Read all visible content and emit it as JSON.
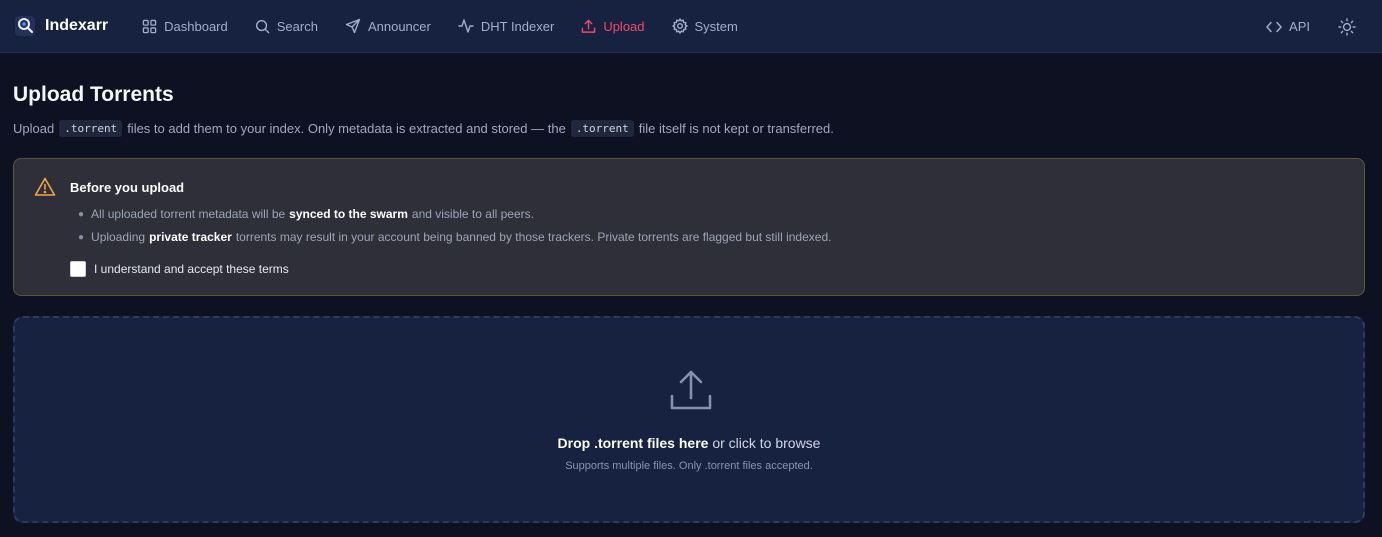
{
  "app": {
    "name": "Indexarr"
  },
  "nav": {
    "items": [
      {
        "label": "Dashboard",
        "icon": "grid-icon"
      },
      {
        "label": "Search",
        "icon": "search-icon"
      },
      {
        "label": "Announcer",
        "icon": "send-icon"
      },
      {
        "label": "DHT Indexer",
        "icon": "activity-icon"
      },
      {
        "label": "Upload",
        "icon": "upload-icon",
        "active": true
      },
      {
        "label": "System",
        "icon": "gear-icon"
      }
    ],
    "api_label": "API"
  },
  "page": {
    "title": "Upload Torrents",
    "subtitle_part1": "Upload",
    "code_term": ".torrent",
    "subtitle_part2": "files to add them to your index. Only metadata is extracted and stored — the",
    "subtitle_part3": "file itself is not kept or transferred."
  },
  "warning": {
    "title": "Before you upload",
    "item1_pre": "All uploaded torrent metadata will be",
    "item1_bold": "synced to the swarm",
    "item1_post": "and visible to all peers.",
    "item2_pre": "Uploading",
    "item2_bold": "private tracker",
    "item2_post": "torrents may result in your account being banned by those trackers. Private torrents are flagged but still indexed.",
    "checkbox_label": "I understand and accept these terms",
    "checkbox_checked": false
  },
  "dropzone": {
    "bold_text": "Drop .torrent files here",
    "text": "or click to browse",
    "hint": "Supports multiple files. Only .torrent files accepted."
  },
  "colors": {
    "accent": "#f24a6a",
    "warning": "#f0a93b",
    "background": "#0e1122",
    "panel": "#172241"
  }
}
